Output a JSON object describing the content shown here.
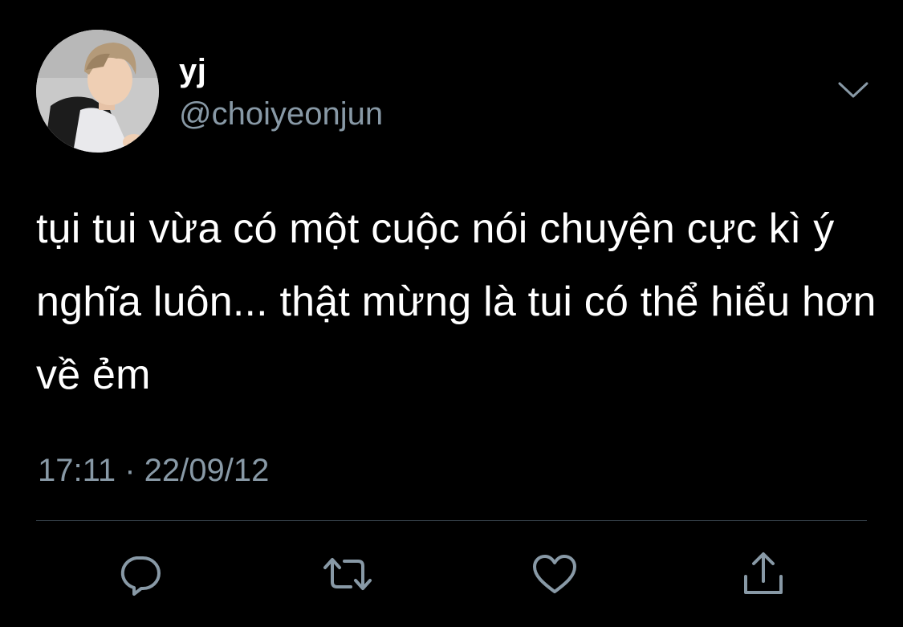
{
  "tweet": {
    "display_name": "yj",
    "handle": "@choiyeonjun",
    "text": "tụi tui vừa có một cuộc nói chuyện cực kì ý nghĩa luôn... thật mừng là tui có thể hiểu hơn về ẻm",
    "timestamp": "17:11 · 22/09/12"
  },
  "icons": {
    "more": "chevron-down-icon",
    "reply": "speech-bubble-icon",
    "retweet": "retweet-icon",
    "like": "heart-icon",
    "share": "share-upload-icon"
  },
  "colors": {
    "background": "#000000",
    "text": "#ffffff",
    "secondary_text": "#8899a6",
    "divider": "#38444d"
  }
}
